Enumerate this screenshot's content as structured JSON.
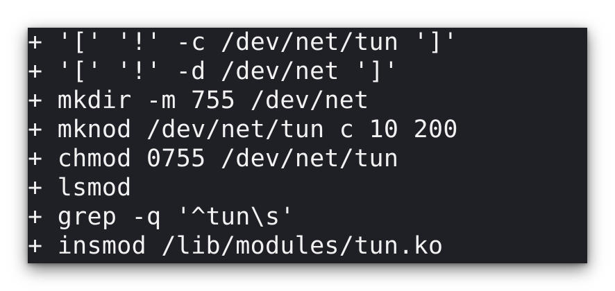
{
  "terminal": {
    "lines": [
      "+ '[' '!' -c /dev/net/tun ']'",
      "+ '[' '!' -d /dev/net ']'",
      "+ mkdir -m 755 /dev/net",
      "+ mknod /dev/net/tun c 10 200",
      "+ chmod 0755 /dev/net/tun",
      "+ lsmod",
      "+ grep -q '^tun\\s'",
      "+ insmod /lib/modules/tun.ko"
    ]
  },
  "colors": {
    "background": "#1f1f26",
    "text": "#f2f2f2"
  }
}
